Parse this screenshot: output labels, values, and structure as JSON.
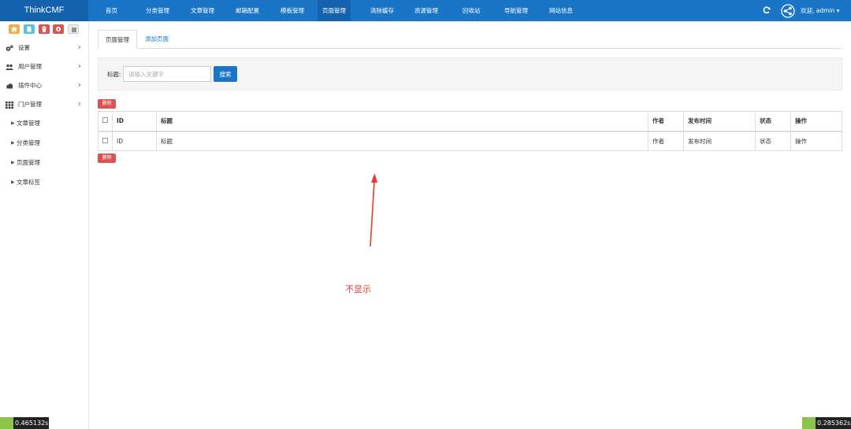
{
  "brand": "ThinkCMF",
  "nav": [
    "首页",
    "分类管理",
    "文章管理",
    "邮箱配置",
    "模板管理",
    "页面管理",
    "清除缓存",
    "资源管理",
    "回收站",
    "导航管理",
    "网站信息"
  ],
  "user_menu": "欢迎, admin ▾",
  "shortcuts": [
    {
      "icon": "home-icon",
      "color": "#f0ad4e"
    },
    {
      "icon": "file-icon",
      "color": "#5bc0de"
    },
    {
      "icon": "trash-icon",
      "color": "#d9534f"
    },
    {
      "icon": "gear-icon",
      "color": "#d9534f"
    },
    {
      "icon": "list-icon",
      "color": "#e8e8e8"
    }
  ],
  "sidebar": {
    "items": [
      {
        "label": "设置",
        "icon": "cogs-icon"
      },
      {
        "label": "用户管理",
        "icon": "users-icon"
      },
      {
        "label": "插件中心",
        "icon": "cloud-icon"
      },
      {
        "label": "门户管理",
        "icon": "grid-icon"
      }
    ],
    "subitems": [
      "文章管理",
      "分类管理",
      "页面管理",
      "文章标签"
    ]
  },
  "tabs": [
    "页面管理",
    "添加页面"
  ],
  "search": {
    "label": "标题:",
    "placeholder": "请输入关键字",
    "button": "搜索"
  },
  "delete_label": "删除",
  "table": {
    "headers": [
      "ID",
      "标题",
      "作者",
      "发布时间",
      "状态",
      "操作"
    ],
    "footer": [
      "ID",
      "标题",
      "作者",
      "发布时间",
      "状态",
      "操作"
    ]
  },
  "annotation": "不显示",
  "perf": [
    "0.465132s",
    "0.285362s"
  ],
  "colors": {
    "primary": "#1b75c7",
    "brand_bg": "#1462ad",
    "danger": "#d9534f",
    "annotation": "#e53935"
  }
}
